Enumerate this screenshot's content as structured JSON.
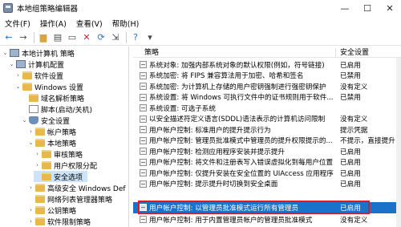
{
  "window": {
    "title": "本地组策略编辑器",
    "controls": {
      "minimize": "—",
      "maximize": "☐",
      "close": "✕"
    }
  },
  "menu": [
    "文件(F)",
    "操作(A)",
    "查看(V)",
    "帮助(H)"
  ],
  "toolbar": {
    "icons": [
      "back-icon",
      "forward-icon",
      "up-folder-icon",
      "show-tree-icon",
      "properties-icon",
      "delete-icon",
      "refresh-icon",
      "export-icon",
      "help-icon",
      "filter-icon"
    ]
  },
  "tree": [
    {
      "label": "本地计算机 策略",
      "icon": "computer",
      "expander": "⌄"
    },
    {
      "label": "计算机配置",
      "icon": "computer",
      "expander": "⌄"
    },
    {
      "label": "软件设置",
      "icon": "folder",
      "expander": "›"
    },
    {
      "label": "Windows 设置",
      "icon": "folder",
      "expander": "⌄"
    },
    {
      "label": "域名解析策略",
      "icon": "folder",
      "expander": ""
    },
    {
      "label": "脚本(启动/关机)",
      "icon": "doc",
      "expander": ""
    },
    {
      "label": "安全设置",
      "icon": "shield",
      "expander": "⌄"
    },
    {
      "label": "帐户策略",
      "icon": "folder",
      "expander": "›"
    },
    {
      "label": "本地策略",
      "icon": "folder",
      "expander": "⌄"
    },
    {
      "label": "审核策略",
      "icon": "folder",
      "expander": "›"
    },
    {
      "label": "用户权限分配",
      "icon": "folder",
      "expander": "›"
    },
    {
      "label": "安全选项",
      "icon": "folder",
      "expander": "",
      "selected": true
    },
    {
      "label": "高级安全 Windows Def",
      "icon": "folder",
      "expander": "›"
    },
    {
      "label": "网络列表管理器策略",
      "icon": "folder",
      "expander": ""
    },
    {
      "label": "公钥策略",
      "icon": "folder",
      "expander": "›"
    },
    {
      "label": "软件限制策略",
      "icon": "folder",
      "expander": "›"
    }
  ],
  "list": {
    "columns": {
      "policy": "策略",
      "setting": "安全设置"
    },
    "rows": [
      {
        "policy": "系统对象: 加强内部系统对象的默认权限(例如，符号链接)",
        "setting": "已启用"
      },
      {
        "policy": "系统加密: 将 FIPS 兼容算法用于加密、哈希和签名",
        "setting": "已禁用"
      },
      {
        "policy": "系统加密: 为计算机上存储的用户密钥强制进行强密钥保护",
        "setting": "没有定义"
      },
      {
        "policy": "系统设置: 将 Windows 可执行文件中的证书规则用于软件...",
        "setting": "已禁用"
      },
      {
        "policy": "系统设置: 可选子系统",
        "setting": ""
      },
      {
        "policy": "以安全描述符定义语言(SDDL)语法表示的计算机访问限制",
        "setting": "没有定义"
      },
      {
        "policy": "用户帐户控制: 标准用户的提升提示行为",
        "setting": "提示凭据"
      },
      {
        "policy": "用户帐户控制: 管理员批准模式中管理员的提升权限提示的...",
        "setting": "不提示，直接提升"
      },
      {
        "policy": "用户帐户控制: 检测应用程序安装并提示提升",
        "setting": "已启用"
      },
      {
        "policy": "用户帐户控制: 将文件和注册表写入错误虚拟化到每用户位置",
        "setting": "已启用"
      },
      {
        "policy": "用户帐户控制: 仅提升安装在安全位置的 UIAccess 应用程序",
        "setting": "已启用"
      },
      {
        "policy": "用户帐户控制: 提示提升时切换到安全桌面",
        "setting": "已启用"
      },
      {
        "policy": "用户帐户控制: 以管理员批准模式运行所有管理员",
        "setting": "已启用",
        "selected": true
      },
      {
        "policy": "用户帐户控制: 用于内置管理员帐户的管理员批准模式",
        "setting": "没有定义"
      }
    ]
  },
  "colors": {
    "selection": "#1a73c9",
    "highlight_border": "#e0181f",
    "tree_selection": "#cce4f7"
  }
}
